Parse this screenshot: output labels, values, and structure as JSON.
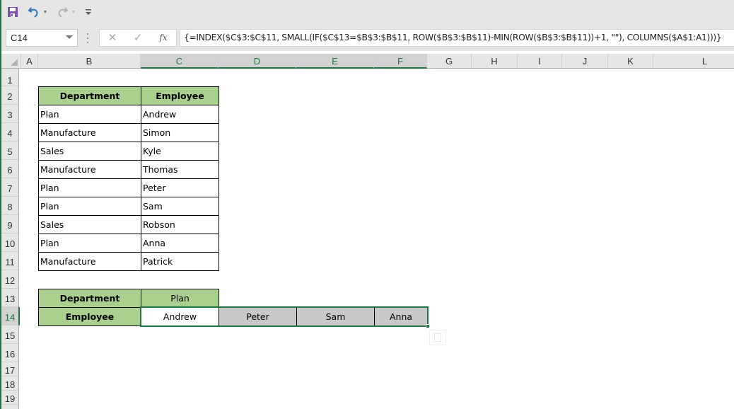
{
  "toolbar": {
    "save_icon": "save-icon",
    "undo_icon": "undo-icon",
    "redo_icon": "redo-icon",
    "customize_icon": "customize-quick-access-icon"
  },
  "formula_bar": {
    "name_box": "C14",
    "cancel_glyph": "✕",
    "enter_glyph": "✓",
    "fx_label": "fx",
    "formula": "{=INDEX($C$3:$C$11, SMALL(IF($C$13=$B$3:$B$11, ROW($B$3:$B$11)-MIN(ROW($B$3:$B$11))+1, \"\"), COLUMNS($A$1:A1)))}"
  },
  "columns": [
    "A",
    "B",
    "C",
    "D",
    "E",
    "F",
    "G",
    "H",
    "I",
    "J",
    "K",
    "L"
  ],
  "selected_columns": [
    "C",
    "D",
    "E",
    "F"
  ],
  "rows": [
    "1",
    "2",
    "3",
    "4",
    "5",
    "6",
    "7",
    "8",
    "9",
    "10",
    "11",
    "12",
    "13",
    "14",
    "15",
    "16",
    "17",
    "18",
    "19"
  ],
  "selected_row": "14",
  "source_table": {
    "headers": [
      "Department",
      "Employee"
    ],
    "rows": [
      [
        "Plan",
        "Andrew"
      ],
      [
        "Manufacture",
        "Simon"
      ],
      [
        "Sales",
        "Kyle"
      ],
      [
        "Manufacture",
        "Thomas"
      ],
      [
        "Plan",
        "Peter"
      ],
      [
        "Plan",
        "Sam"
      ],
      [
        "Sales",
        "Robson"
      ],
      [
        "Plan",
        "Anna"
      ],
      [
        "Manufacture",
        "Patrick"
      ]
    ]
  },
  "lookup": {
    "department_label": "Department",
    "department_value": "Plan",
    "employee_label": "Employee",
    "results": [
      "Andrew",
      "Peter",
      "Sam",
      "Anna"
    ]
  },
  "colors": {
    "accent": "#217346",
    "header_fill": "#a9d08e",
    "selected_fill": "#c9c9c9"
  }
}
